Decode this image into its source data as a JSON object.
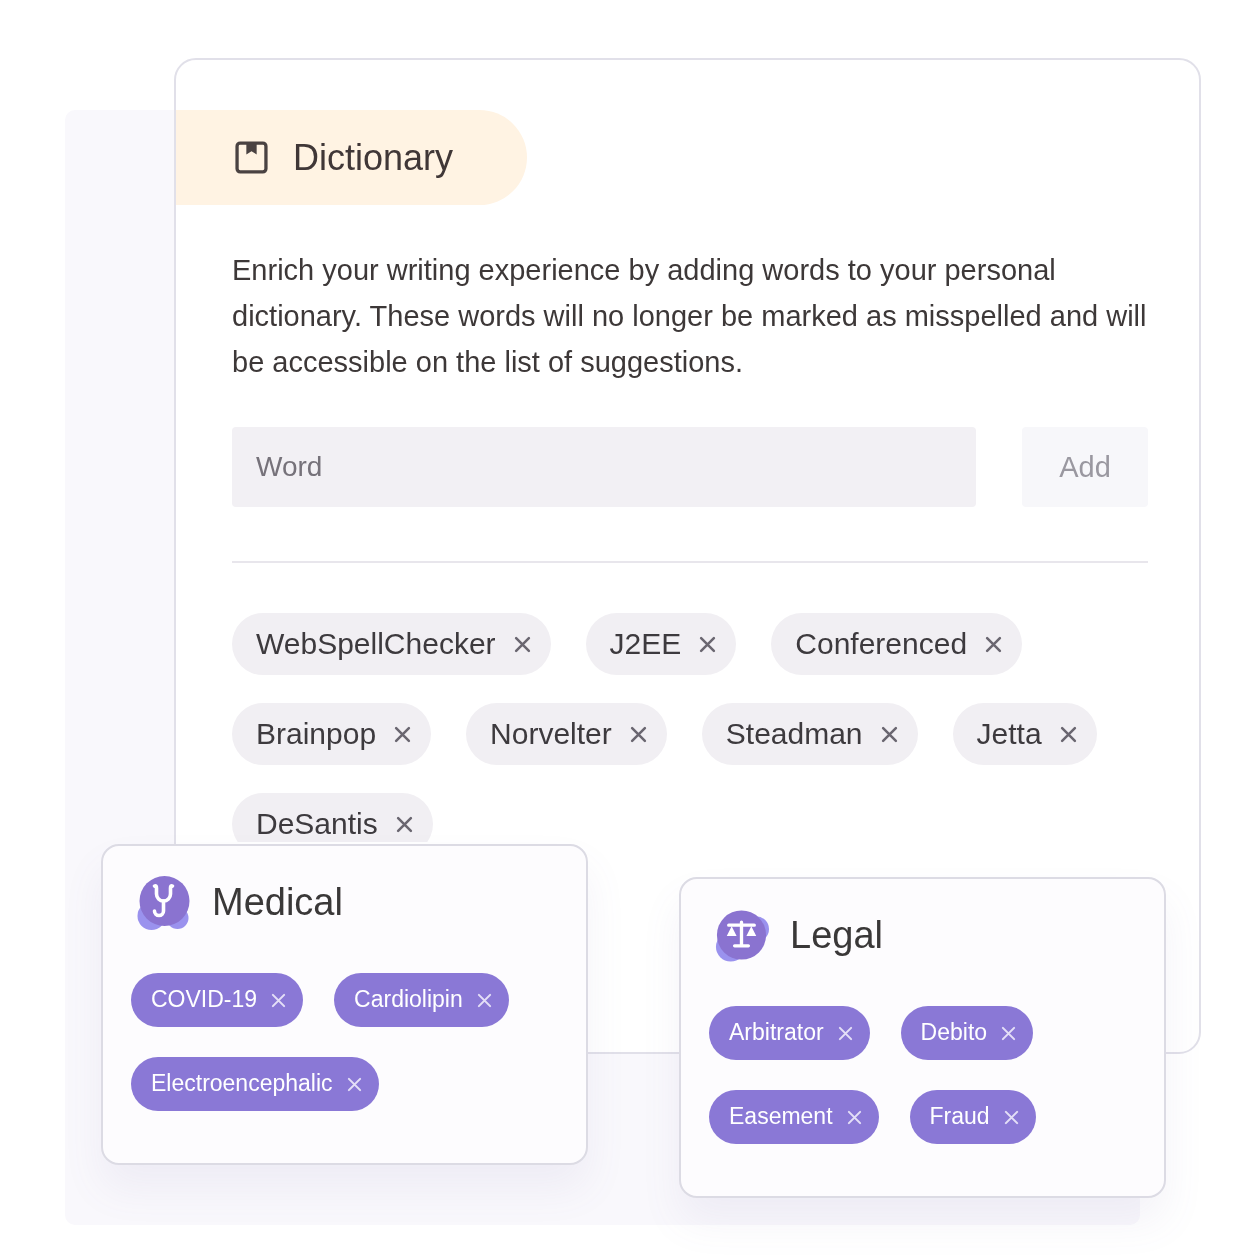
{
  "dictionary": {
    "title": "Dictionary",
    "description": "Enrich your writing experience by adding words to your personal dictionary. These words will no longer be marked as misspelled and will be accessible on the list of suggestions.",
    "word_field": {
      "placeholder": "Word"
    },
    "add_button": {
      "label": "Add",
      "disabled": true
    },
    "words": [
      "WebSpellChecker",
      "J2EE",
      "Conferenced",
      "Brainpop",
      "Norvelter",
      "Steadman",
      "Jetta",
      "DeSantis"
    ]
  },
  "categories": [
    {
      "kind": "medical",
      "title": "Medical",
      "words": [
        "COVID-19",
        "Cardiolipin",
        "Electroencephalic"
      ]
    },
    {
      "kind": "legal",
      "title": "Legal",
      "words": [
        "Arbitrator",
        "Debito",
        "Easement",
        "Fraud"
      ]
    }
  ]
}
